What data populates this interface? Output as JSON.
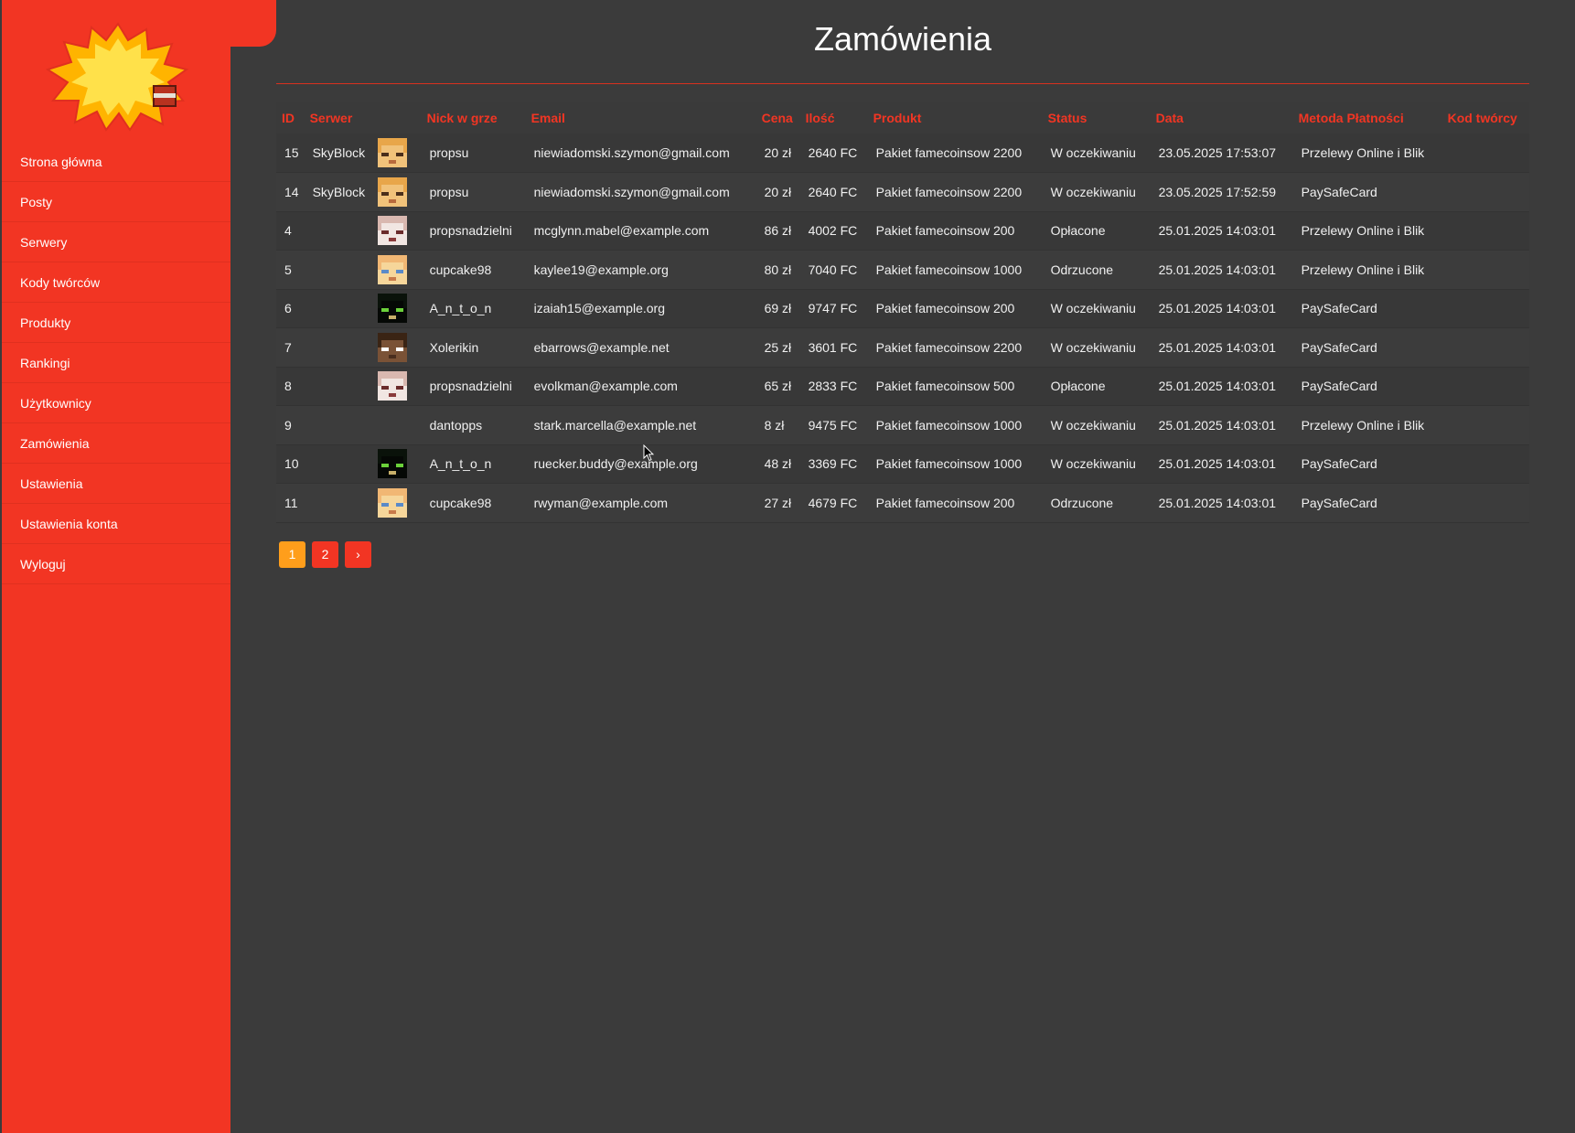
{
  "sidebar": {
    "logo_alt": "FAME CRAFT",
    "items": [
      {
        "label": "Strona główna"
      },
      {
        "label": "Posty"
      },
      {
        "label": "Serwery"
      },
      {
        "label": "Kody twórców"
      },
      {
        "label": "Produkty"
      },
      {
        "label": "Rankingi"
      },
      {
        "label": "Użytkownicy"
      },
      {
        "label": "Zamówienia"
      },
      {
        "label": "Ustawienia"
      },
      {
        "label": "Ustawienia konta"
      },
      {
        "label": "Wyloguj"
      }
    ]
  },
  "main": {
    "title": "Zamówienia",
    "columns": [
      "ID",
      "Serwer",
      "",
      "Nick w grze",
      "Email",
      "Cena",
      "Ilość",
      "Produkt",
      "Status",
      "Data",
      "Metoda Płatności",
      "Kod twórcy"
    ],
    "rows": [
      {
        "id": "15",
        "server": "SkyBlock",
        "avatar": "skin-blonde",
        "nick": "propsu",
        "email": "niewiadomski.szymon@gmail.com",
        "price": "20 zł",
        "amount": "2640 FC",
        "product": "Pakiet famecoinsow 2200",
        "status": "W oczekiwaniu",
        "status_type": "pending",
        "date": "23.05.2025 17:53:07",
        "payment": "Przelewy Online i Blik",
        "code": ""
      },
      {
        "id": "14",
        "server": "SkyBlock",
        "avatar": "skin-blonde",
        "nick": "propsu",
        "email": "niewiadomski.szymon@gmail.com",
        "price": "20 zł",
        "amount": "2640 FC",
        "product": "Pakiet famecoinsow 2200",
        "status": "W oczekiwaniu",
        "status_type": "pending",
        "date": "23.05.2025 17:52:59",
        "payment": "PaySafeCard",
        "code": ""
      },
      {
        "id": "4",
        "server": "",
        "avatar": "skin-white",
        "nick": "propsnadzielni",
        "email": "mcglynn.mabel@example.com",
        "price": "86 zł",
        "amount": "4002 FC",
        "product": "Pakiet famecoinsow 200",
        "status": "Opłacone",
        "status_type": "paid",
        "date": "25.01.2025 14:03:01",
        "payment": "Przelewy Online i Blik",
        "code": ""
      },
      {
        "id": "5",
        "server": "",
        "avatar": "skin-cupcake",
        "nick": "cupcake98",
        "email": "kaylee19@example.org",
        "price": "80 zł",
        "amount": "7040 FC",
        "product": "Pakiet famecoinsow 1000",
        "status": "Odrzucone",
        "status_type": "rejected",
        "date": "25.01.2025 14:03:01",
        "payment": "Przelewy Online i Blik",
        "code": ""
      },
      {
        "id": "6",
        "server": "",
        "avatar": "skin-dark",
        "nick": "A_n_t_o_n",
        "email": "izaiah15@example.org",
        "price": "69 zł",
        "amount": "9747 FC",
        "product": "Pakiet famecoinsow 200",
        "status": "W oczekiwaniu",
        "status_type": "pending",
        "date": "25.01.2025 14:03:01",
        "payment": "PaySafeCard",
        "code": ""
      },
      {
        "id": "7",
        "server": "",
        "avatar": "skin-steve",
        "nick": "Xolerikin",
        "email": "ebarrows@example.net",
        "price": "25 zł",
        "amount": "3601 FC",
        "product": "Pakiet famecoinsow 2200",
        "status": "W oczekiwaniu",
        "status_type": "pending",
        "date": "25.01.2025 14:03:01",
        "payment": "PaySafeCard",
        "code": ""
      },
      {
        "id": "8",
        "server": "",
        "avatar": "skin-white",
        "nick": "propsnadzielni",
        "email": "evolkman@example.com",
        "price": "65 zł",
        "amount": "2833 FC",
        "product": "Pakiet famecoinsow 500",
        "status": "Opłacone",
        "status_type": "paid",
        "date": "25.01.2025 14:03:01",
        "payment": "PaySafeCard",
        "code": ""
      },
      {
        "id": "9",
        "server": "",
        "avatar": "",
        "nick": "dantopps",
        "email": "stark.marcella@example.net",
        "price": "8 zł",
        "amount": "9475 FC",
        "product": "Pakiet famecoinsow 1000",
        "status": "W oczekiwaniu",
        "status_type": "pending",
        "date": "25.01.2025 14:03:01",
        "payment": "Przelewy Online i Blik",
        "code": ""
      },
      {
        "id": "10",
        "server": "",
        "avatar": "skin-dark",
        "nick": "A_n_t_o_n",
        "email": "ruecker.buddy@example.org",
        "price": "48 zł",
        "amount": "3369 FC",
        "product": "Pakiet famecoinsow 1000",
        "status": "W oczekiwaniu",
        "status_type": "pending",
        "date": "25.01.2025 14:03:01",
        "payment": "PaySafeCard",
        "code": ""
      },
      {
        "id": "11",
        "server": "",
        "avatar": "skin-cupcake",
        "nick": "cupcake98",
        "email": "rwyman@example.com",
        "price": "27 zł",
        "amount": "4679 FC",
        "product": "Pakiet famecoinsow 200",
        "status": "Odrzucone",
        "status_type": "rejected",
        "date": "25.01.2025 14:03:01",
        "payment": "PaySafeCard",
        "code": ""
      }
    ],
    "pagination": {
      "pages": [
        "1",
        "2"
      ],
      "current": "1",
      "next_label": "›"
    }
  },
  "colors": {
    "accent": "#f23523",
    "pending": "#ff8a1e",
    "paid": "#2fbe53",
    "rejected": "#ff2a1f",
    "active_page": "#ff9e1b",
    "background": "#3b3b3b"
  }
}
